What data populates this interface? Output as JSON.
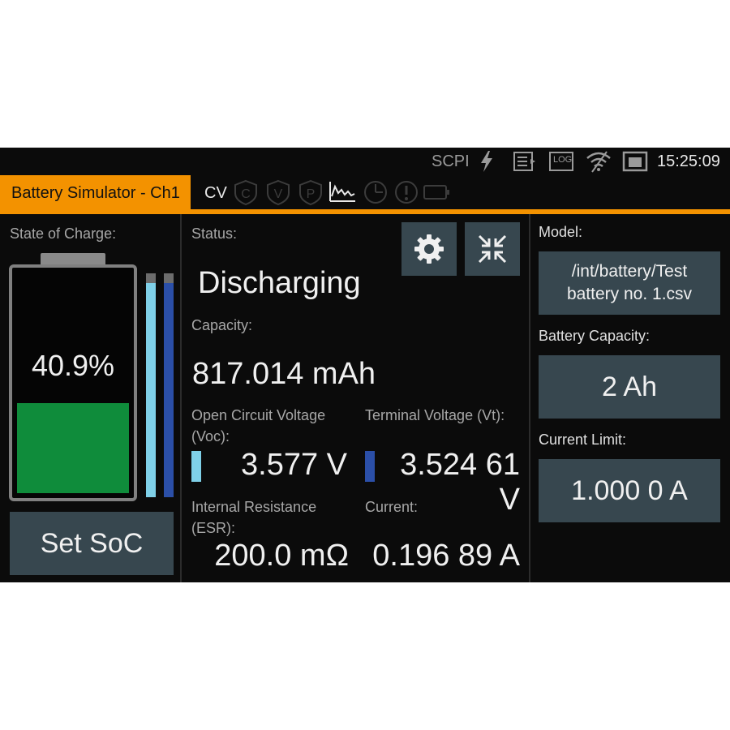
{
  "status_bar": {
    "scpi": "SCPI",
    "log": "LOG",
    "time": "15:25:09"
  },
  "title": "Battery Simulator - Ch1",
  "mode": "CV",
  "mode_icons": [
    "C",
    "V",
    "P"
  ],
  "left": {
    "state_of_charge_label": "State of Charge:",
    "soc_text": "40.9%",
    "soc_percent": 40.9,
    "ocv_bar_fraction": 0.96,
    "vt_bar_fraction": 0.96,
    "set_soc_button": "Set SoC"
  },
  "center": {
    "status_label": "Status:",
    "status_value": "Discharging",
    "capacity_label": "Capacity:",
    "capacity_value": "817.014 mAh",
    "ocv_label_1": "Open Circuit Voltage",
    "ocv_label_2": "(Voc):",
    "ocv_value": "3.577 V",
    "vt_label": "Terminal Voltage (Vt):",
    "vt_value": "3.524 61 V",
    "esr_label_1": "Internal Resistance",
    "esr_label_2": "(ESR):",
    "esr_value": "200.0 mΩ",
    "current_label": "Current:",
    "current_value": "0.196 89 A"
  },
  "right": {
    "model_label": "Model:",
    "model_value_1": "/int/battery/Test",
    "model_value_2": "battery no. 1.csv",
    "capacity_label": "Battery Capacity:",
    "capacity_value": "2 Ah",
    "current_limit_label": "Current Limit:",
    "current_limit_value": "1.000 0 A"
  },
  "colors": {
    "accent": "#f39200",
    "battery_fill": "#0f8c3b",
    "ocv_indicator": "#7fd0e8",
    "vt_indicator": "#2b4fa8",
    "button_bg": "#37474f"
  }
}
